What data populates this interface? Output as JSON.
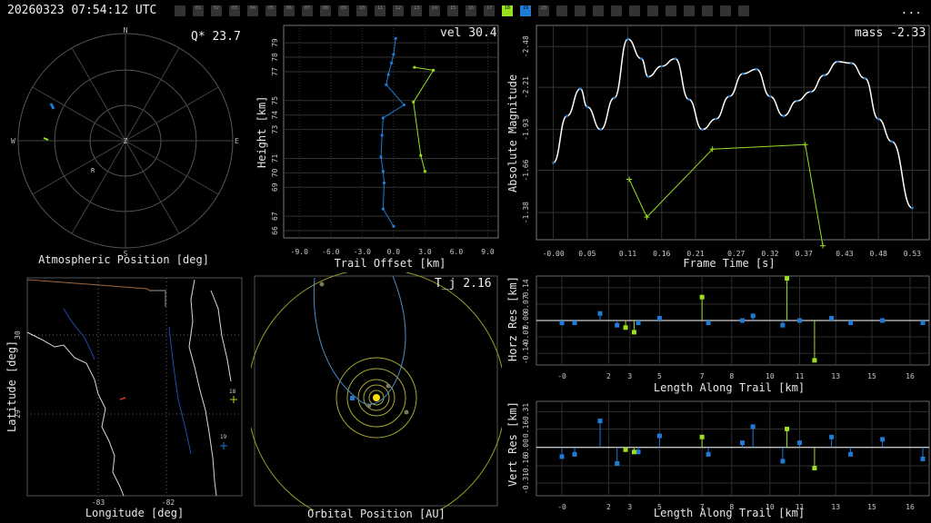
{
  "header": {
    "timestamp": "20260323 07:54:12 UTC",
    "menu_label": "...",
    "cameras": [
      {
        "id": "",
        "state": "off"
      },
      {
        "id": "01",
        "state": "off"
      },
      {
        "id": "02",
        "state": "off"
      },
      {
        "id": "03",
        "state": "off"
      },
      {
        "id": "04",
        "state": "off"
      },
      {
        "id": "05",
        "state": "off"
      },
      {
        "id": "06",
        "state": "off"
      },
      {
        "id": "07",
        "state": "off"
      },
      {
        "id": "08",
        "state": "off"
      },
      {
        "id": "09",
        "state": "off"
      },
      {
        "id": "10",
        "state": "off"
      },
      {
        "id": "11",
        "state": "off"
      },
      {
        "id": "12",
        "state": "off"
      },
      {
        "id": "13",
        "state": "off"
      },
      {
        "id": "14",
        "state": "off"
      },
      {
        "id": "15",
        "state": "off"
      },
      {
        "id": "16",
        "state": "off"
      },
      {
        "id": "17",
        "state": "off"
      },
      {
        "id": "18",
        "state": "green"
      },
      {
        "id": "19",
        "state": "blue"
      },
      {
        "id": "20",
        "state": "off"
      },
      {
        "id": "",
        "state": "off"
      },
      {
        "id": "",
        "state": "off"
      },
      {
        "id": "",
        "state": "off"
      },
      {
        "id": "",
        "state": "off"
      },
      {
        "id": "",
        "state": "off"
      },
      {
        "id": "",
        "state": "off"
      },
      {
        "id": "",
        "state": "off"
      },
      {
        "id": "",
        "state": "off"
      },
      {
        "id": "",
        "state": "off"
      },
      {
        "id": "",
        "state": "off"
      },
      {
        "id": "",
        "state": "off"
      }
    ]
  },
  "colors": {
    "blue": "#1e7bd6",
    "green": "#9be01e",
    "white": "#ffffff",
    "grid": "#3a3a3a",
    "axis": "#cfcfcf"
  },
  "polar": {
    "title": "Atmospheric Position [deg]",
    "tag": "Q* 23.7",
    "directions": {
      "n": "N",
      "s": "S",
      "e": "E",
      "w": "W",
      "z": "Z"
    },
    "marker": "R"
  },
  "trail": {
    "xlabel": "Trail Offset [km]",
    "ylabel": "Height [km]",
    "tag": "vel 30.4",
    "xticks": [
      "-9.0",
      "-6.0",
      "-3.0",
      "0.0",
      "3.0",
      "6.0",
      "9.0"
    ],
    "yticks": [
      "66",
      "67",
      "69",
      "70",
      "71",
      "73",
      "74",
      "75",
      "77",
      "78",
      "79"
    ],
    "xlim": [
      -10.5,
      10
    ],
    "ylim": [
      65.5,
      80.2
    ]
  },
  "mag": {
    "xlabel": "Frame Time [s]",
    "ylabel": "Absolute Magnitude",
    "tag": "mass -2.33",
    "xticks": [
      "-0.00",
      "0.05",
      "0.11",
      "0.16",
      "0.21",
      "0.27",
      "0.32",
      "0.37",
      "0.43",
      "0.48",
      "0.53"
    ],
    "yticks": [
      "-2.48",
      "-2.21",
      "-1.93",
      "-1.66",
      "-1.38"
    ],
    "xlim": [
      -0.025,
      0.555
    ],
    "ylim": [
      -2.62,
      -1.2
    ]
  },
  "map": {
    "xlabel": "Longitude [deg]",
    "ylabel": "Latitude [deg]",
    "xticks": [
      "-83",
      "-82"
    ],
    "yticks": [
      "30",
      "29"
    ],
    "labels": [
      "18",
      "19"
    ]
  },
  "orbit": {
    "xlabel": "Orbital Position [AU]",
    "tag": "T_j 2.16"
  },
  "hres": {
    "xlabel": "Length Along Trail [km]",
    "ylabel": "Horz Res [km]",
    "xticks": [
      "-0",
      "2",
      "3",
      "5",
      "7",
      "8",
      "10",
      "11",
      "13",
      "15",
      "16"
    ],
    "yticks": [
      "0.14",
      "0.07",
      "0.00",
      "-0.07",
      "-0.14"
    ],
    "xlim": [
      -1.2,
      17.3
    ],
    "ylim": [
      -0.19,
      0.19
    ]
  },
  "vres": {
    "xlabel": "Length Along Trail [km]",
    "ylabel": "Vert Res [km]",
    "xticks": [
      "-0",
      "2",
      "3",
      "5",
      "7",
      "8",
      "10",
      "11",
      "13",
      "15",
      "16"
    ],
    "yticks": [
      "0.31",
      "0.16",
      "0.00",
      "-0.16",
      "-0.31"
    ],
    "xlim": [
      -1.2,
      17.3
    ],
    "ylim": [
      -0.42,
      0.4
    ]
  },
  "chart_data": [
    {
      "type": "line",
      "title": "",
      "xlabel": "Trail Offset [km]",
      "ylabel": "Height [km]",
      "series": [
        {
          "color": "blue",
          "x": [
            0.2,
            0.0,
            -0.2,
            -0.5,
            -0.7,
            1.0,
            -1.0,
            -1.1,
            -1.2,
            -1.0,
            -0.9,
            -1.0,
            0.0
          ],
          "y": [
            79.3,
            78.2,
            77.6,
            76.8,
            76.1,
            74.7,
            73.8,
            72.6,
            71.1,
            70.1,
            69.3,
            67.5,
            66.3
          ]
        },
        {
          "color": "green",
          "x": [
            2.0,
            3.8,
            1.9,
            2.6,
            3.0
          ],
          "y": [
            77.3,
            77.1,
            74.9,
            71.2,
            70.1
          ]
        }
      ]
    },
    {
      "type": "line",
      "xlabel": "Frame Time [s]",
      "ylabel": "Absolute Magnitude",
      "series": [
        {
          "color": "blue",
          "x": [
            0.0,
            0.02,
            0.04,
            0.05,
            0.07,
            0.09,
            0.11,
            0.13,
            0.14,
            0.16,
            0.18,
            0.2,
            0.22,
            0.24,
            0.26,
            0.28,
            0.3,
            0.32,
            0.34,
            0.36,
            0.38,
            0.4,
            0.42,
            0.44,
            0.46,
            0.48,
            0.5,
            0.53
          ],
          "y": [
            -1.71,
            -2.02,
            -2.2,
            -2.08,
            -1.93,
            -2.14,
            -2.53,
            -2.4,
            -2.28,
            -2.35,
            -2.4,
            -2.13,
            -1.93,
            -2.0,
            -2.15,
            -2.3,
            -2.33,
            -2.15,
            -2.02,
            -2.12,
            -2.18,
            -2.29,
            -2.38,
            -2.37,
            -2.27,
            -2.0,
            -1.85,
            -1.41
          ]
        },
        {
          "color": "green",
          "x": [
            0.112,
            0.138,
            0.235,
            0.372,
            0.398
          ],
          "y": [
            -1.6,
            -1.35,
            -1.8,
            -1.83,
            -1.16
          ]
        }
      ]
    },
    {
      "type": "scatter",
      "xlabel": "Length Along Trail [km]",
      "ylabel": "Horz Res [km]",
      "series": [
        {
          "color": "blue",
          "x": [
            -0.0,
            0.6,
            1.8,
            2.6,
            3.6,
            4.6,
            6.9,
            8.5,
            9.0,
            10.4,
            11.2,
            12.7,
            13.6,
            15.1,
            17.0
          ],
          "y": [
            -0.01,
            -0.01,
            0.03,
            -0.02,
            -0.01,
            0.01,
            -0.01,
            0.0,
            0.02,
            -0.02,
            0.0,
            0.01,
            -0.01,
            0.0,
            -0.01
          ]
        },
        {
          "color": "green",
          "x": [
            3.0,
            3.4,
            6.6,
            10.6,
            11.9
          ],
          "y": [
            -0.03,
            -0.05,
            0.1,
            0.18,
            -0.17
          ]
        }
      ]
    },
    {
      "type": "scatter",
      "xlabel": "Length Along Trail [km]",
      "ylabel": "Vert Res [km]",
      "series": [
        {
          "color": "blue",
          "x": [
            -0.0,
            0.6,
            1.8,
            2.6,
            3.6,
            4.6,
            6.9,
            8.5,
            9.0,
            10.4,
            11.2,
            12.7,
            13.6,
            15.1,
            17.0
          ],
          "y": [
            -0.08,
            -0.06,
            0.23,
            -0.14,
            -0.04,
            0.1,
            -0.06,
            0.04,
            0.18,
            -0.12,
            0.04,
            0.09,
            -0.06,
            0.07,
            -0.1
          ]
        },
        {
          "color": "green",
          "x": [
            3.0,
            3.4,
            6.6,
            10.6,
            11.9
          ],
          "y": [
            -0.02,
            -0.04,
            0.09,
            0.16,
            -0.18
          ]
        }
      ]
    }
  ]
}
